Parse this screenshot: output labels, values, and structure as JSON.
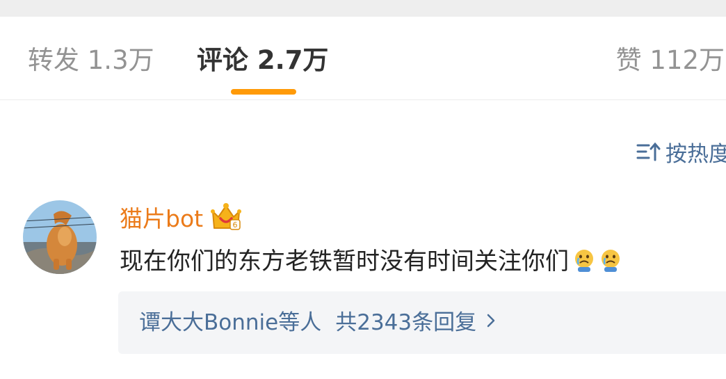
{
  "tabs": {
    "reposts": {
      "label": "转发",
      "count": "1.3万"
    },
    "comments": {
      "label": "评论",
      "count": "2.7万"
    },
    "likes": {
      "label": "赞",
      "count": "112万"
    }
  },
  "sort": {
    "label": "按热度"
  },
  "comment": {
    "username": "猫片bot",
    "text": "现在你们的东方老铁暂时没有时间关注你们",
    "emoji_icon": "crying-face-emoji",
    "badge_icon": "vip-crown-badge"
  },
  "replies": {
    "names": "谭大大Bonnie等人",
    "count_text": "共2343条回复"
  },
  "colors": {
    "accent": "#ff9a08",
    "link": "#4a6e98",
    "username": "#eb7b1a",
    "reply_bg": "#f4f5f7"
  }
}
